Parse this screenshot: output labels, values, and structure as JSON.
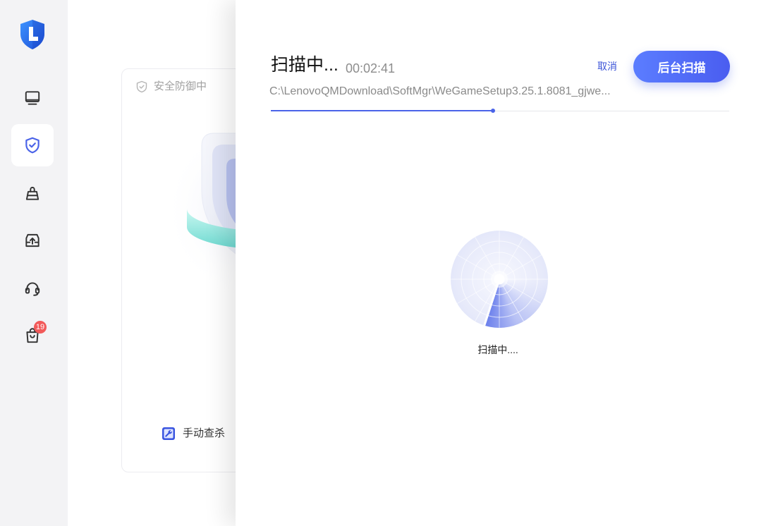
{
  "app": {
    "logo_icon": "lenovo-shield-logo-icon"
  },
  "sidebar": {
    "items": [
      {
        "icon": "monitor-icon",
        "selected": false
      },
      {
        "icon": "shield-check-icon",
        "selected": true
      },
      {
        "icon": "clean-bag-icon",
        "selected": false
      },
      {
        "icon": "drive-upload-icon",
        "selected": false
      },
      {
        "icon": "headset-icon",
        "selected": false
      },
      {
        "icon": "shopping-bag-icon",
        "selected": false,
        "badge": "19"
      }
    ]
  },
  "protection_card": {
    "status_label": "安全防御中",
    "status_icon": "shield-check-outline-icon",
    "manual_scan_label": "手动查杀",
    "manual_scan_icon": "wrench-icon"
  },
  "scan_panel": {
    "title": "扫描中...",
    "elapsed": "00:02:41",
    "cancel_label": "取消",
    "background_scan_label": "后台扫描",
    "current_file": "C:\\LenovoQMDownload\\SoftMgr\\WeGameSetup3.25.1.8081_gjwe...",
    "progress": 0.485,
    "radar_label": "扫描中...."
  },
  "colors": {
    "accent": "#4a63e8",
    "badge": "#f25a5a",
    "sidebar_bg": "#f3f3f5"
  }
}
